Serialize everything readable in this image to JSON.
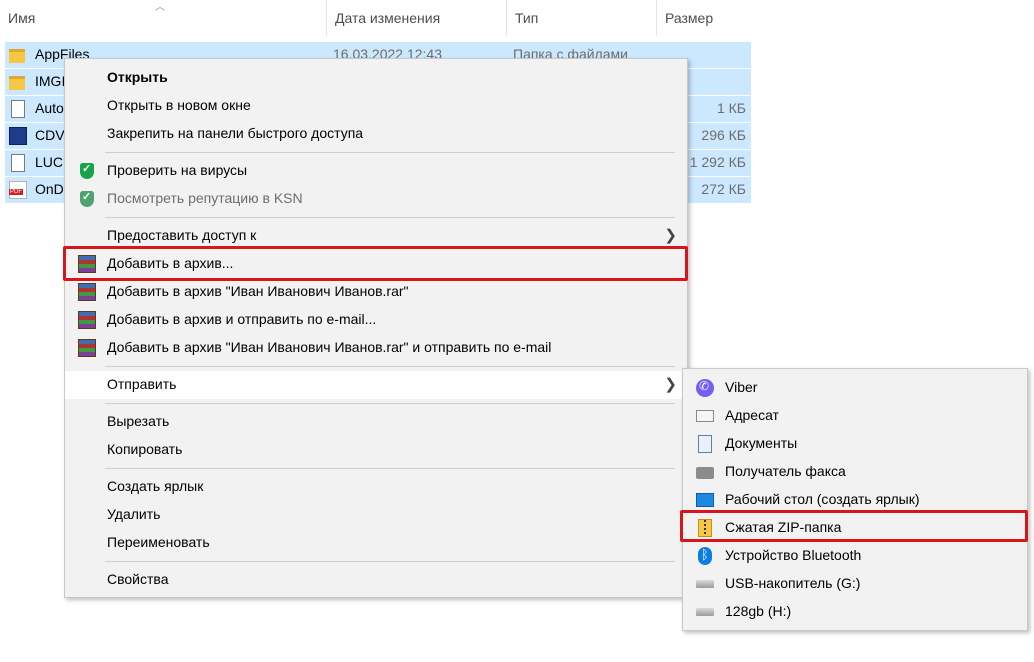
{
  "header": {
    "columns": [
      "Имя",
      "Дата изменения",
      "Тип",
      "Размер"
    ]
  },
  "files": [
    {
      "name": "AppFiles",
      "date": "16.03.2022 12:43",
      "type": "Папка с файлами",
      "size": "",
      "icon": "folder-icon"
    },
    {
      "name": "IMGI",
      "date": "",
      "type": "",
      "size": "",
      "icon": "folder-icon"
    },
    {
      "name": "Auto",
      "date": "",
      "type": "",
      "size": "1 КБ",
      "icon": "file-icon"
    },
    {
      "name": "CDV",
      "date": "",
      "type": "",
      "size": "296 КБ",
      "icon": "app-icon"
    },
    {
      "name": "LUCI",
      "date": "",
      "type": "",
      "size": "1 292 КБ",
      "icon": "file-icon"
    },
    {
      "name": "OnD",
      "date": "",
      "type": "",
      "size": "272 КБ",
      "icon": "pdf-icon"
    }
  ],
  "context_menu": {
    "items": [
      {
        "label": "Открыть"
      },
      {
        "label": "Открыть в новом окне"
      },
      {
        "label": "Закрепить на панели быстрого доступа"
      },
      {
        "label": "Проверить на вирусы",
        "icon": "kaspersky-shield-icon"
      },
      {
        "label": "Посмотреть репутацию в KSN",
        "icon": "kaspersky-shield-icon"
      },
      {
        "label": "Предоставить доступ к"
      },
      {
        "label": "Добавить в архив...",
        "icon": "winrar-icon"
      },
      {
        "label": "Добавить в архив \"Иван Иванович Иванов.rar\"",
        "icon": "winrar-icon"
      },
      {
        "label": "Добавить в архив и отправить по e-mail...",
        "icon": "winrar-icon"
      },
      {
        "label": "Добавить в архив \"Иван Иванович Иванов.rar\" и отправить по e-mail",
        "icon": "winrar-icon"
      },
      {
        "label": "Отправить"
      },
      {
        "label": "Вырезать"
      },
      {
        "label": "Копировать"
      },
      {
        "label": "Создать ярлык"
      },
      {
        "label": "Удалить"
      },
      {
        "label": "Переименовать"
      },
      {
        "label": "Свойства"
      }
    ]
  },
  "send_to_menu": {
    "items": [
      {
        "label": "Viber",
        "icon": "viber-icon"
      },
      {
        "label": "Адресат",
        "icon": "mail-recipient-icon"
      },
      {
        "label": "Документы",
        "icon": "documents-icon"
      },
      {
        "label": "Получатель факса",
        "icon": "fax-icon"
      },
      {
        "label": "Рабочий стол (создать ярлык)",
        "icon": "desktop-icon"
      },
      {
        "label": "Сжатая ZIP-папка",
        "icon": "zip-folder-icon"
      },
      {
        "label": "Устройство Bluetooth",
        "icon": "bluetooth-icon"
      },
      {
        "label": "USB-накопитель (G:)",
        "icon": "usb-drive-icon"
      },
      {
        "label": "128gb (H:)",
        "icon": "usb-drive-icon"
      }
    ]
  },
  "colors": {
    "selection": "#cce8ff",
    "menu_bg": "#f2f2f2",
    "highlight_red": "#d6161b"
  }
}
